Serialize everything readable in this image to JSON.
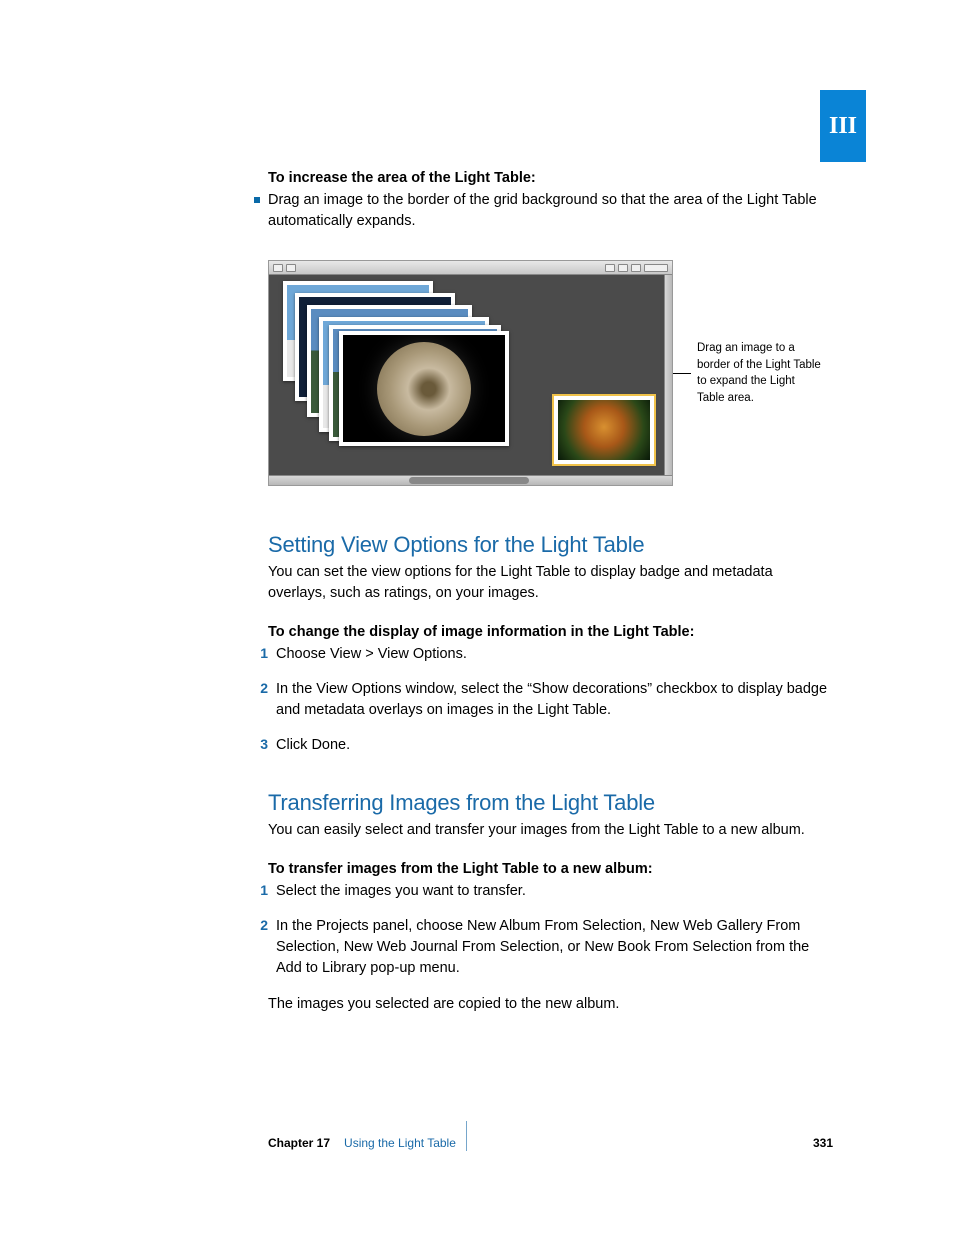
{
  "part_label": "III",
  "increase": {
    "heading": "To increase the area of the Light Table:",
    "bullet": "Drag an image to the border of the grid background so that the area of the Light Table automatically expands."
  },
  "callout": "Drag an image to a border of the Light Table to expand the Light Table area.",
  "section1": {
    "title": "Setting View Options for the Light Table",
    "intro": "You can set the view options for the Light Table to display badge and metadata overlays, such as ratings, on your images.",
    "sub": "To change the display of image information in the Light Table:",
    "steps": [
      "Choose View > View Options.",
      "In the View Options window, select the “Show decorations” checkbox to display badge and metadata overlays on images in the Light Table.",
      "Click Done."
    ]
  },
  "section2": {
    "title": "Transferring Images from the Light Table",
    "intro": "You can easily select and transfer your images from the Light Table to a new album.",
    "sub": "To transfer images from the Light Table to a new album:",
    "steps": [
      "Select the images you want to transfer.",
      "In the Projects panel, choose New Album From Selection, New Web Gallery From Selection, New Web Journal From Selection, or New Book From Selection from the Add to Library pop-up menu."
    ],
    "outro": "The images you selected are copied to the new album."
  },
  "footer": {
    "chapter": "Chapter 17",
    "title": "Using the Light Table",
    "page": "331"
  }
}
